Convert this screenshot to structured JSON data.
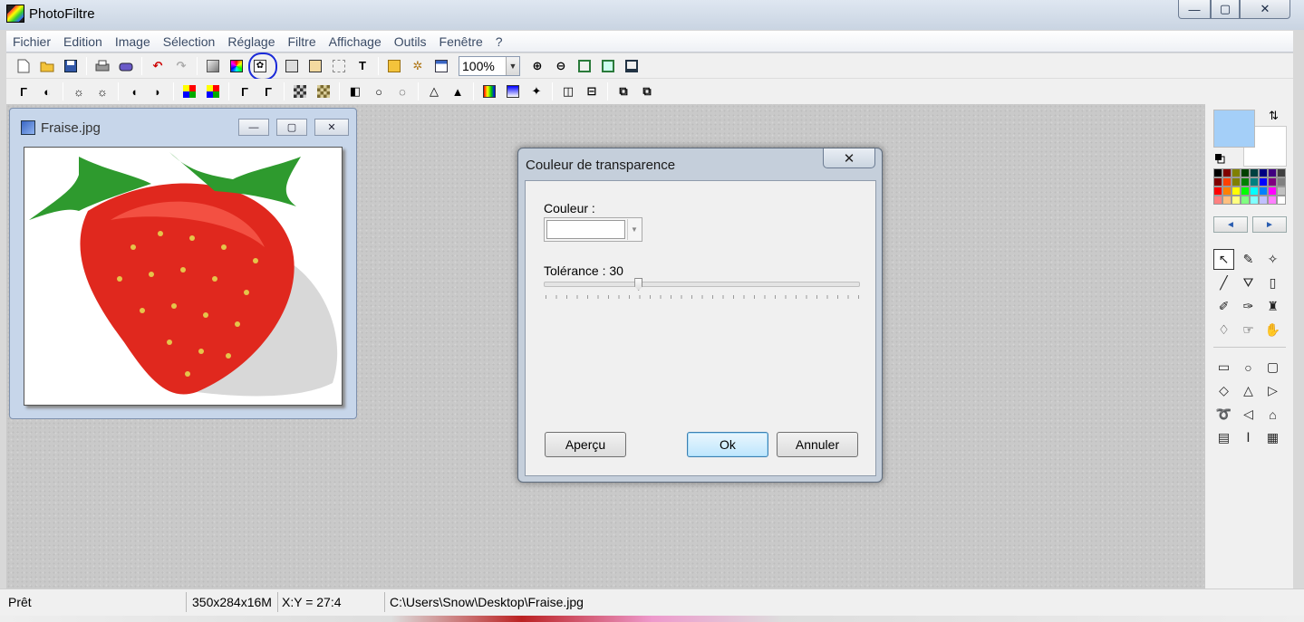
{
  "app": {
    "title": "PhotoFiltre"
  },
  "window_controls": {
    "minimize": "—",
    "maximize": "▢",
    "close": "✕"
  },
  "menu": [
    "Fichier",
    "Edition",
    "Image",
    "Sélection",
    "Réglage",
    "Filtre",
    "Affichage",
    "Outils",
    "Fenêtre",
    "?"
  ],
  "toolbar": {
    "zoom_value": "100%",
    "zoom_arrow": "▼",
    "text_tool": "T"
  },
  "image_window": {
    "title": "Fraise.jpg",
    "min": "—",
    "max": "▢",
    "close": "✕"
  },
  "dialog": {
    "title": "Couleur de transparence",
    "close": "✕",
    "couleur_label": "Couleur :",
    "couleur_value": "#ffffff",
    "tolerance_label": "Tolérance : 30",
    "tolerance_value": 30,
    "tolerance_max": 100,
    "buttons": {
      "apercu": "Aperçu",
      "ok": "Ok",
      "annuler": "Annuler"
    }
  },
  "colors": {
    "foreground": "#a4cff8",
    "background": "#ffffff",
    "highlight_circle": "#1a2ad8"
  },
  "palette": [
    "#000000",
    "#800000",
    "#808000",
    "#004000",
    "#004040",
    "#000080",
    "#400080",
    "#404040",
    "#800000",
    "#ff4000",
    "#808000",
    "#008000",
    "#008080",
    "#0000ff",
    "#800080",
    "#808080",
    "#ff0000",
    "#ff8000",
    "#ffff00",
    "#00ff00",
    "#00ffff",
    "#0080ff",
    "#ff00ff",
    "#c0c0c0",
    "#ff8080",
    "#ffc080",
    "#ffff80",
    "#80ff80",
    "#80ffff",
    "#c0c0ff",
    "#ff80ff",
    "#ffffff"
  ],
  "palette_nav": {
    "left": "◄",
    "right": "►"
  },
  "statusbar": {
    "status": "Prêt",
    "size": "350x284x16M",
    "coords": "X:Y = 27:4",
    "path": "C:\\Users\\Snow\\Desktop\\Fraise.jpg"
  }
}
